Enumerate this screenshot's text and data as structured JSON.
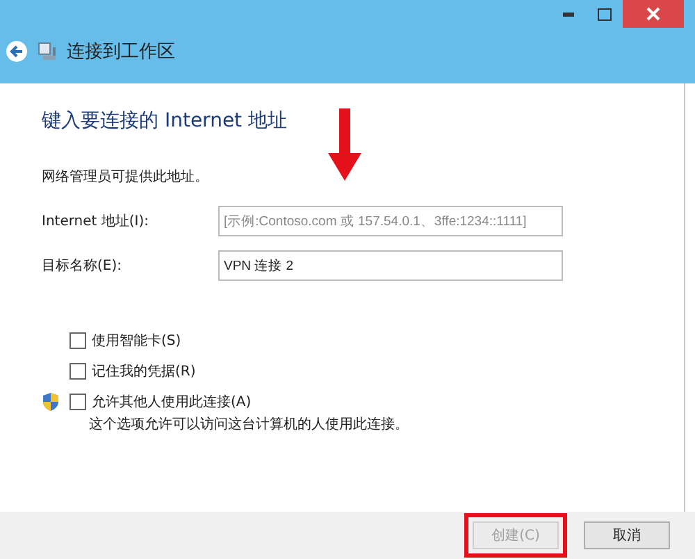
{
  "window": {
    "title": "连接到工作区"
  },
  "heading": "键入要连接的 Internet 地址",
  "note": "网络管理员可提供此地址。",
  "fields": [
    {
      "label": "Internet 地址(I):",
      "placeholder": "[示例:Contoso.com 或 157.54.0.1、3ffe:1234::1111]"
    },
    {
      "label": "目标名称(E):",
      "value": "VPN 连接 2"
    }
  ],
  "options": [
    {
      "label": "使用智能卡(S)",
      "checked": false,
      "shield": false
    },
    {
      "label": "记住我的凭据(R)",
      "checked": false,
      "shield": false
    },
    {
      "label": "允许其他人使用此连接(A)",
      "checked": false,
      "shield": true
    }
  ],
  "description": "这个选项允许可以访问这台计算机的人使用此连接。",
  "buttons": [
    {
      "label": "创建(C)",
      "disabled": true,
      "highlighted": true
    },
    {
      "label": "取消",
      "disabled": false,
      "highlighted": false
    }
  ]
}
